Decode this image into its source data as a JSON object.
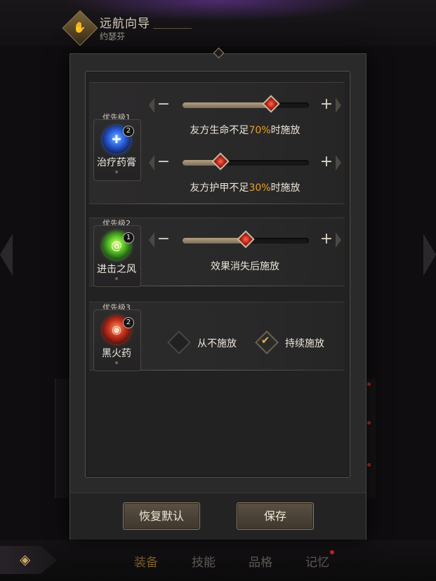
{
  "guide": {
    "title": "远航向导",
    "subtitle": "约瑟芬",
    "emblem_icon": "hand-icon"
  },
  "tabs": [
    {
      "label": "装备",
      "active": true
    },
    {
      "label": "技能",
      "active": false
    },
    {
      "label": "品格",
      "active": false
    },
    {
      "label": "记忆",
      "active": false,
      "badge": true
    }
  ],
  "rows": [
    {
      "priority": "优先级1",
      "item_name": "治疗药膏",
      "count": "2",
      "icon": "healing-salve-icon",
      "conditions": [
        {
          "before": "友方生命不足",
          "pct": "70%",
          "after": "时施放",
          "value_fraction": 0.7
        },
        {
          "before": "友方护甲不足",
          "pct": "30%",
          "after": "时施放",
          "value_fraction": 0.3
        }
      ]
    },
    {
      "priority": "优先级2",
      "item_name": "进击之风",
      "count": "1",
      "icon": "wind-orb-icon",
      "conditions": [
        {
          "before": "效果消失后施放",
          "pct": "",
          "after": "",
          "value_fraction": 0.5
        }
      ]
    },
    {
      "priority": "优先级3",
      "item_name": "黑火药",
      "count": "2",
      "icon": "black-powder-icon",
      "options": [
        {
          "label": "从不施放",
          "checked": false
        },
        {
          "label": "持续施放",
          "checked": true
        }
      ]
    }
  ],
  "buttons": {
    "reset": "恢复默认",
    "save": "保存"
  },
  "colors": {
    "accent_gold": "#e7a12a",
    "knob_red": "#c2271b"
  }
}
